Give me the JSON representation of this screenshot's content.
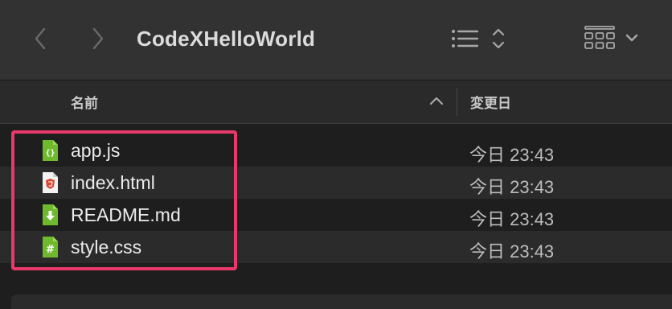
{
  "window": {
    "title": "CodeXHelloWorld"
  },
  "toolbar": {
    "back_icon": "chevron-left-icon",
    "forward_icon": "chevron-right-icon",
    "list_view_icon": "list-view-icon",
    "grid_view_icon": "icon-grid-view-icon"
  },
  "columns": {
    "name": "名前",
    "date": "変更日",
    "sort": "ascending"
  },
  "files": [
    {
      "name": "app.js",
      "date": "今日 23:43",
      "icon": "javascript-file-icon"
    },
    {
      "name": "index.html",
      "date": "今日 23:43",
      "icon": "html-file-icon"
    },
    {
      "name": "README.md",
      "date": "今日 23:43",
      "icon": "markdown-file-icon"
    },
    {
      "name": "style.css",
      "date": "今日 23:43",
      "icon": "css-file-icon"
    }
  ],
  "colors": {
    "highlight": "#e8396a",
    "icon_green": "#6fb92c",
    "icon_red": "#d9452f"
  }
}
